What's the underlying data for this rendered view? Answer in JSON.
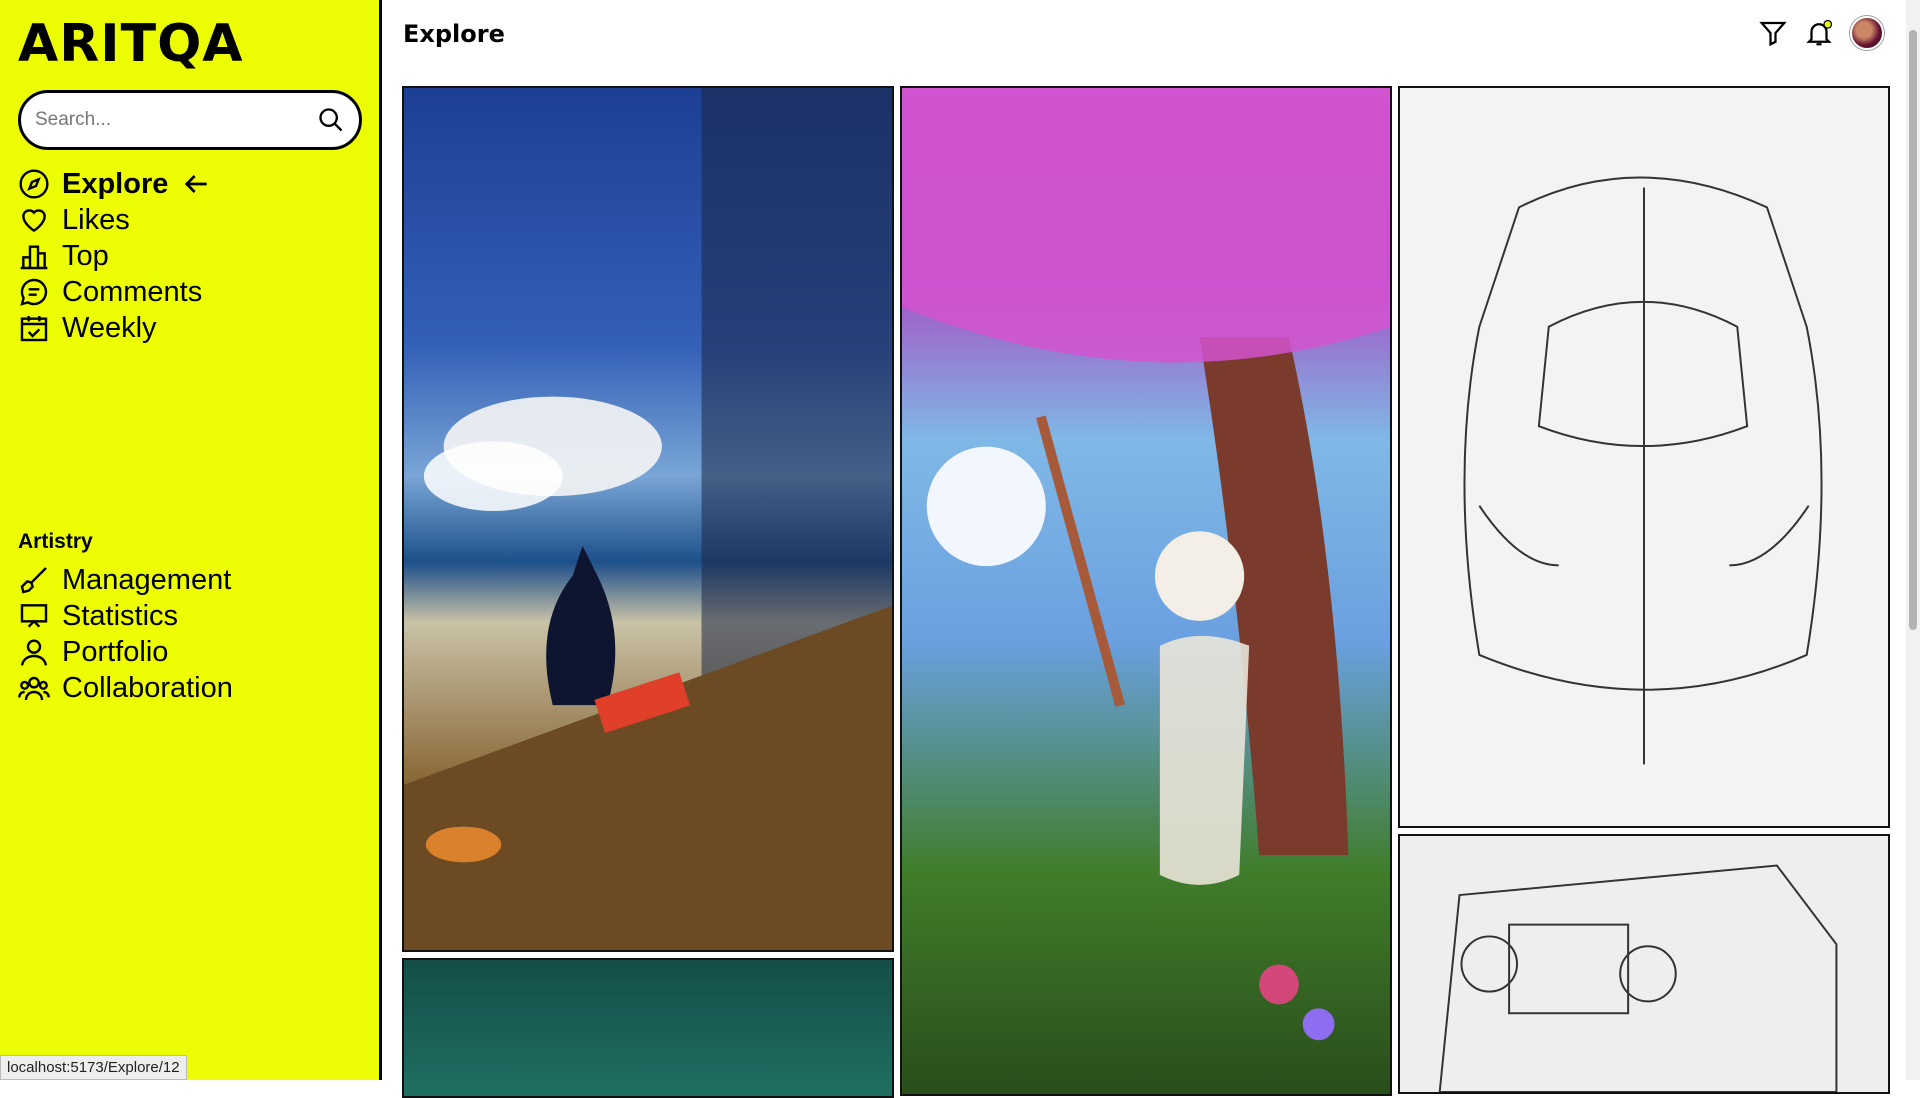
{
  "brand": {
    "logo": "ARITQA"
  },
  "search": {
    "placeholder": "Search..."
  },
  "nav": {
    "items": [
      {
        "label": "Explore",
        "icon": "compass-icon",
        "active": true
      },
      {
        "label": "Likes",
        "icon": "heart-icon"
      },
      {
        "label": "Top",
        "icon": "podium-icon"
      },
      {
        "label": "Comments",
        "icon": "chat-icon"
      },
      {
        "label": "Weekly",
        "icon": "calendar-check-icon"
      }
    ]
  },
  "artistry": {
    "title": "Artistry",
    "items": [
      {
        "label": "Management",
        "icon": "brush-icon"
      },
      {
        "label": "Statistics",
        "icon": "presentation-icon"
      },
      {
        "label": "Portfolio",
        "icon": "user-icon"
      },
      {
        "label": "Collaboration",
        "icon": "users-icon"
      }
    ]
  },
  "header": {
    "title": "Explore"
  },
  "status_url": "localhost:5173/Explore/12",
  "colors": {
    "accent": "#edfd03"
  }
}
